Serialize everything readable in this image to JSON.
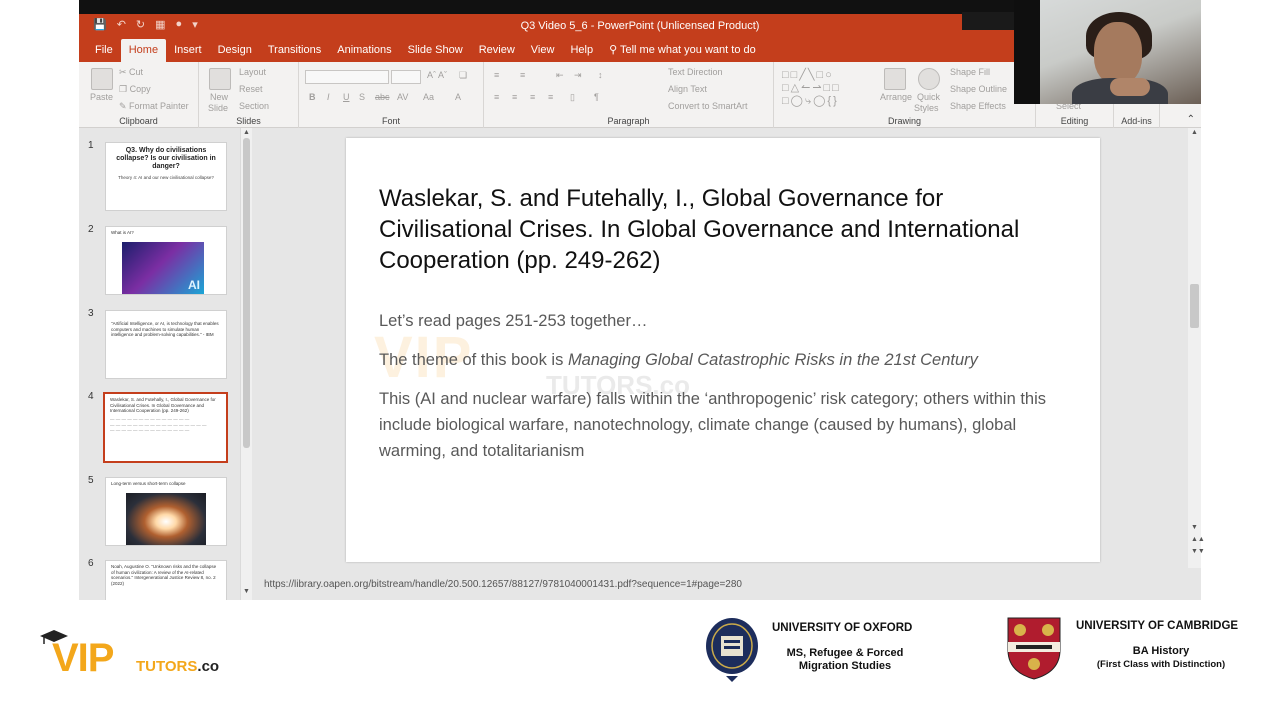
{
  "window": {
    "title": "Q3 Video 5_6  -  PowerPoint (Unlicensed Product)"
  },
  "ribbon_tabs": [
    "File",
    "Home",
    "Insert",
    "Design",
    "Transitions",
    "Animations",
    "Slide Show",
    "Review",
    "View",
    "Help"
  ],
  "tell_me": "Tell me what you want to do",
  "ribbon": {
    "clipboard": {
      "label": "Clipboard",
      "paste": "Paste",
      "cut": "Cut",
      "copy": "Copy",
      "format_painter": "Format Painter"
    },
    "slides": {
      "label": "Slides",
      "new_slide_1": "New",
      "new_slide_2": "Slide",
      "layout": "Layout",
      "reset": "Reset",
      "section": "Section"
    },
    "font": {
      "label": "Font"
    },
    "paragraph": {
      "label": "Paragraph",
      "text_direction": "Text Direction",
      "align_text": "Align Text",
      "convert_smartart": "Convert to SmartArt"
    },
    "drawing": {
      "label": "Drawing",
      "arrange": "Arrange",
      "quick_styles_1": "Quick",
      "quick_styles_2": "Styles",
      "shape_fill": "Shape Fill",
      "shape_outline": "Shape Outline",
      "shape_effects": "Shape Effects"
    },
    "editing": {
      "label": "Editing",
      "select": "Select"
    },
    "addins": {
      "label": "Add-ins"
    }
  },
  "thumbnails": [
    {
      "num": "1",
      "title": "Q3. Why do civilisations collapse? Is our civilisation in danger?",
      "sub": "Theory 4: AI and our new civilisational collapse?"
    },
    {
      "num": "2",
      "small": "What is AI?",
      "image_label": "AI"
    },
    {
      "num": "3",
      "small": "\"Artificial Intelligence, or AI, is technology that enables computers and machines to simulate human intelligence and problem-solving capabilities.\" - IBM"
    },
    {
      "num": "4",
      "small": "Waslekar, S. and Futehally, I., Global Governance for Civilisational Crises. In Global Governance and International Cooperation (pp. 249-262)"
    },
    {
      "num": "5",
      "small": "Long-term versus short-term collapse"
    },
    {
      "num": "6",
      "small": "Noah, Augustine O. \"Unknown risks and the collapse of human civilization: A review of the AI-related scenarios.\" Intergenerational Justice Review 8, no. 2 (2022)"
    }
  ],
  "slide": {
    "title": "Waslekar, S. and Futehally, I., Global Governance for Civilisational Crises. In Global Governance and International Cooperation (pp. 249-262)",
    "line1": "Let’s read pages 251-253 together…",
    "line2_prefix": "The theme of this book is ",
    "line2_italic": "Managing Global Catastrophic Risks in the 21st Century",
    "para": "This (AI and nuclear warfare) falls within the ‘anthropogenic’ risk category; others within this include biological warfare, nanotechnology, climate change (caused by humans), global warming, and totalitarianism",
    "watermark_main": "VIP",
    "watermark_sub": "TUTORS.co"
  },
  "status_url": "https://library.oapen.org/bitstream/handle/20.500.12657/88127/9781040001431.pdf?sequence=1#page=280",
  "branding": {
    "vip_letters": "VIP",
    "vip_tutors": "TUTORS",
    "vip_co": ".co",
    "oxford_title": "UNIVERSITY OF OXFORD",
    "oxford_sub": "MS, Refugee & Forced Migration Studies",
    "cambridge_title": "UNIVERSITY OF CAMBRIDGE",
    "cambridge_sub": "BA History",
    "cambridge_sub2": "(First Class with Distinction)"
  },
  "colors": {
    "accent": "#c43e1c",
    "ribbon_bg": "#f3f2f1",
    "vip_orange": "#f3a71b",
    "oxford_blue": "#1d2d5c",
    "cambridge_red": "#b01c2e"
  }
}
